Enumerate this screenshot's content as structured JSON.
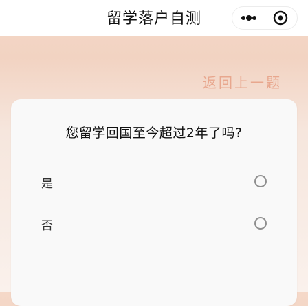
{
  "navbar": {
    "title": "留学落户自测",
    "more_icon": "more-dots-icon",
    "close_icon": "close-circle-icon"
  },
  "back_link": "返回上一题",
  "question": "您留学回国至今超过2年了吗?",
  "options": [
    {
      "label": "是",
      "selected": false
    },
    {
      "label": "否",
      "selected": false
    }
  ],
  "colors": {
    "accent": "#e8a78e",
    "background_top": "#f5d8c8",
    "card": "#f9f9f9"
  }
}
